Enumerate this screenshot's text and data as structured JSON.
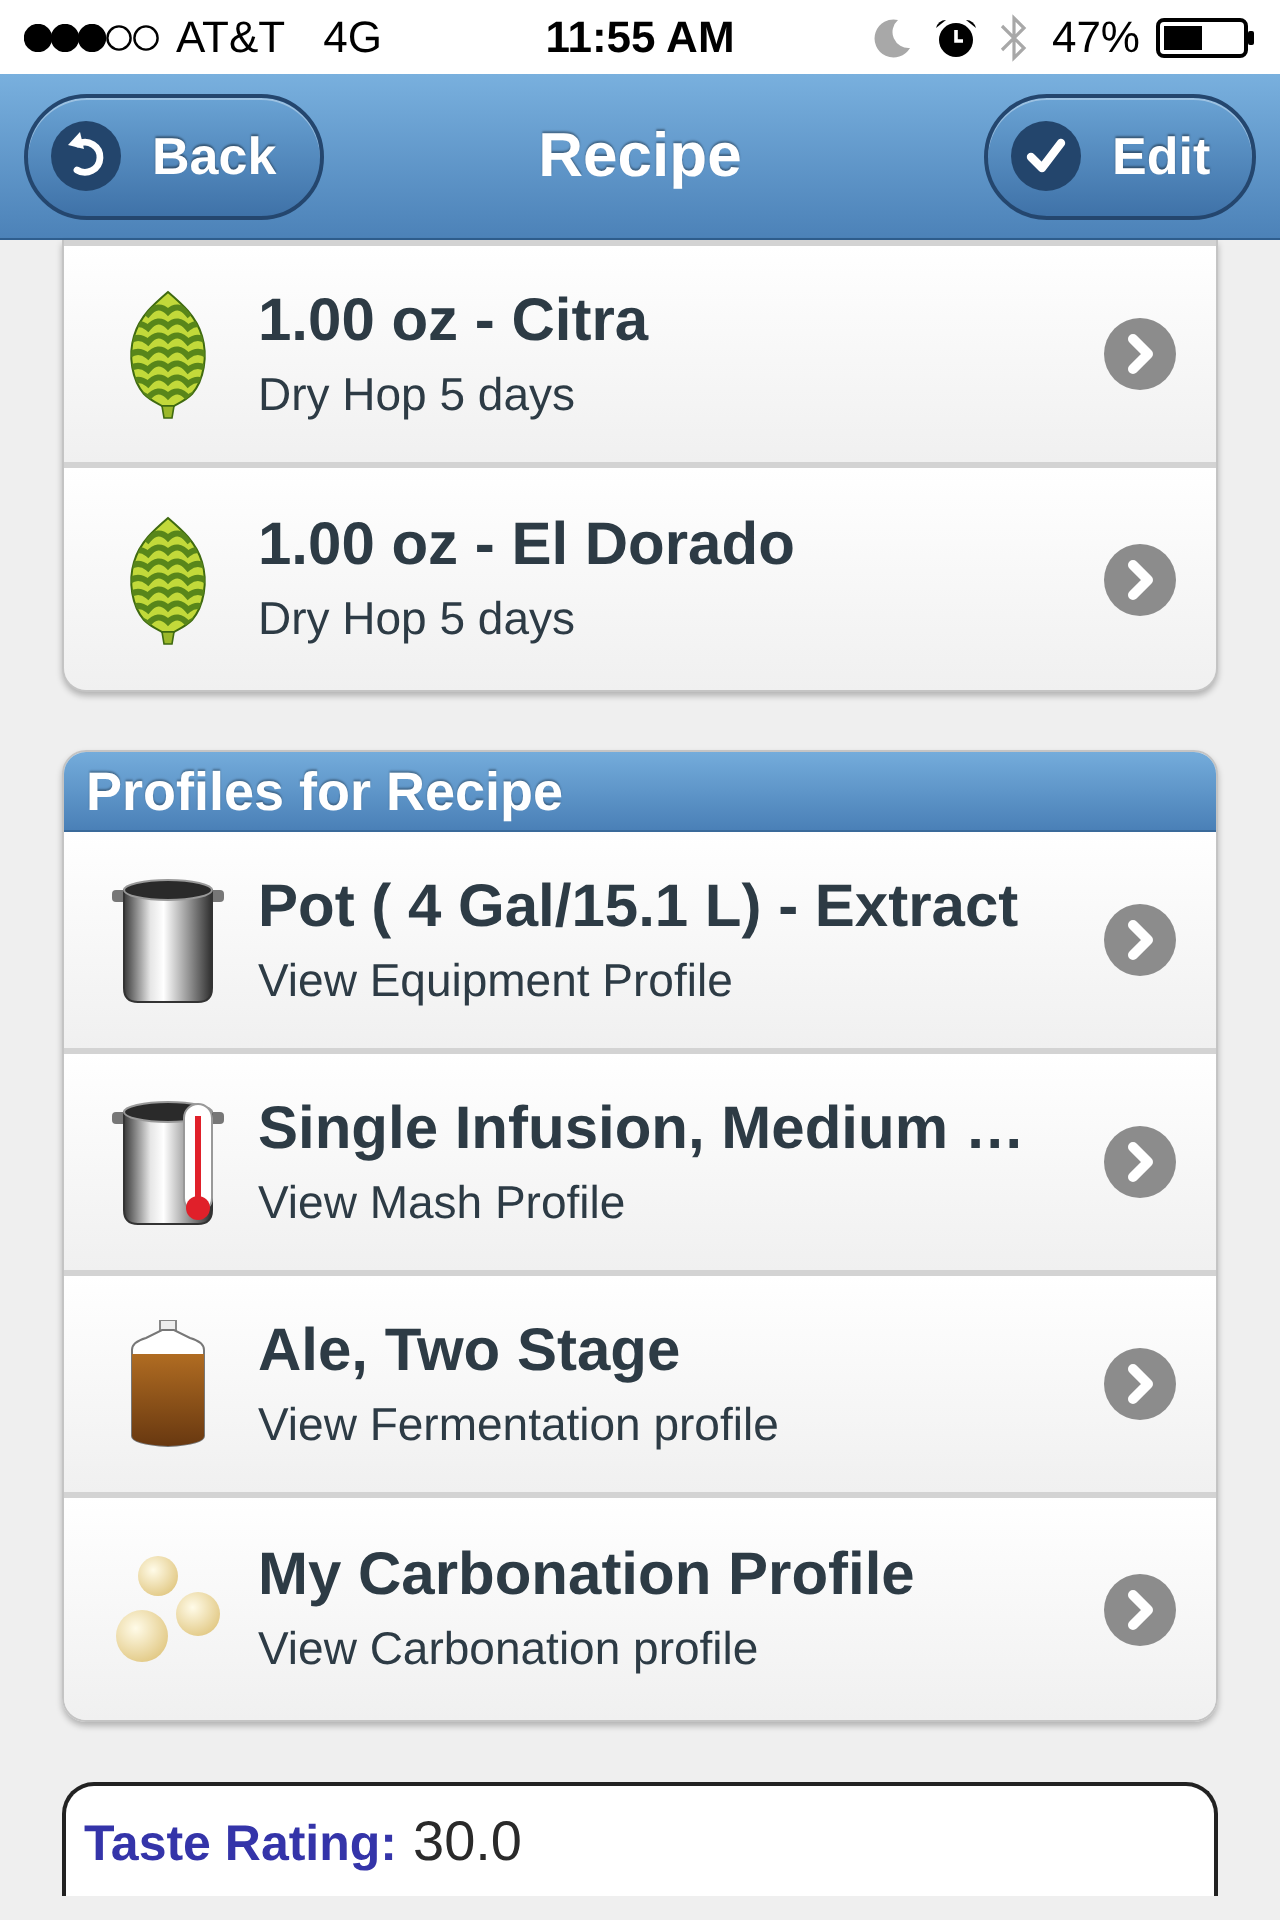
{
  "status_bar": {
    "carrier": "AT&T",
    "network": "4G",
    "time": "11:55 AM",
    "battery": "47%"
  },
  "nav_bar": {
    "back": "Back",
    "title": "Recipe",
    "edit": "Edit"
  },
  "hops": [
    {
      "kind": "hop",
      "title": "1.00 oz - Citra",
      "subtitle": "Dry Hop 5 days"
    },
    {
      "kind": "hop",
      "title": "1.00 oz - El Dorado",
      "subtitle": "Dry Hop 5 days"
    }
  ],
  "profiles": {
    "header": "Profiles for Recipe",
    "items": [
      {
        "kind": "equipment",
        "title": "Pot ( 4 Gal/15.1 L) - Extract",
        "subtitle": "View Equipment Profile"
      },
      {
        "kind": "mash",
        "title": "Single Infusion, Medium …",
        "subtitle": "View Mash Profile"
      },
      {
        "kind": "fermentation",
        "title": "Ale, Two Stage",
        "subtitle": "View Fermentation profile"
      },
      {
        "kind": "carbonation",
        "title": "My Carbonation Profile",
        "subtitle": "View Carbonation profile"
      }
    ]
  },
  "taste_rating": {
    "label": "Taste Rating:",
    "value": "30.0"
  }
}
